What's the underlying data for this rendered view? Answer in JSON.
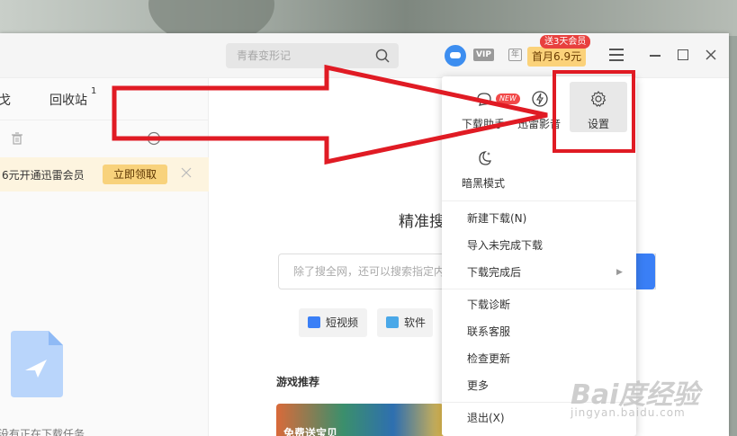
{
  "titlebar": {
    "search_placeholder": "青春变形记",
    "vip_label": "VIP",
    "year_label": "年",
    "promo_label": "首月6.9元",
    "promo_tag": "送3天会员"
  },
  "sidebar": {
    "tab_left": "戈",
    "tab_recycle": "回收站",
    "recycle_count": "1",
    "vip_bar_text": "6元开通迅雷会员",
    "vip_claim": "立即领取",
    "empty_text": "没有正在下载任务"
  },
  "main": {
    "heading": "精准搜",
    "search_placeholder": "除了搜全网，还可以搜索指定内",
    "chips": [
      {
        "label": "短视频"
      },
      {
        "label": "软件"
      }
    ],
    "section_title": "游戏推荐",
    "game_text": "免费送宝贝"
  },
  "menu": {
    "tiles": [
      {
        "label": "下载助手",
        "badge": "NEW",
        "icon": "download-assistant-icon"
      },
      {
        "label": "迅雷影音",
        "icon": "player-icon"
      },
      {
        "label": "设置",
        "icon": "gear-icon"
      },
      {
        "label": "暗黑模式",
        "icon": "moon-icon"
      }
    ],
    "items": [
      "新建下载(N)",
      "导入未完成下载",
      "下载完成后",
      "下载诊断",
      "联系客服",
      "检查更新",
      "更多",
      "退出(X)"
    ],
    "submenu_arrow": "▶"
  },
  "watermark": {
    "main": "Bai度经验",
    "sub": "jingyan.baidu.com"
  },
  "colors": {
    "accent": "#3a7ff6",
    "annotation_red": "#e01b24",
    "promo_bg": "#fbd27a",
    "promo_tag_bg": "#e8403e"
  }
}
